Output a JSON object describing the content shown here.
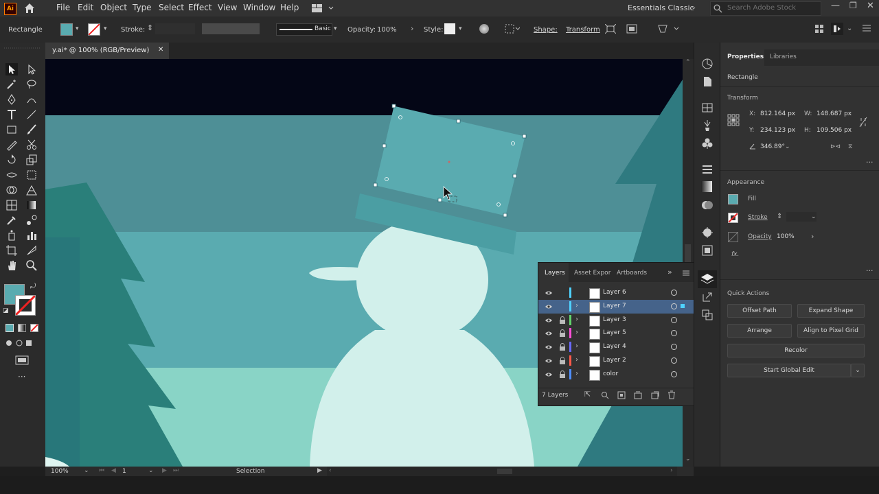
{
  "menubar": {
    "app_badge": "Ai",
    "items": [
      "File",
      "Edit",
      "Object",
      "Type",
      "Select",
      "Effect",
      "View",
      "Window",
      "Help"
    ],
    "workspace": "Essentials Classic",
    "search_placeholder": "Search Adobe Stock"
  },
  "controlbar": {
    "object_type": "Rectangle",
    "stroke_label": "Stroke:",
    "brush_label": "Basic",
    "opacity_label": "Opacity:",
    "opacity_value": "100%",
    "style_label": "Style:",
    "shape_label": "Shape:",
    "transform_label": "Transform",
    "fill_color": "#5aabb0"
  },
  "document": {
    "tab_title": "y.ai* @ 100% (RGB/Preview)",
    "close_glyph": "✕"
  },
  "status": {
    "zoom": "100%",
    "artboard": "1",
    "tool": "Selection"
  },
  "layers_panel": {
    "tabs": [
      "Layers",
      "Asset Expor",
      "Artboards"
    ],
    "rows": [
      {
        "name": "Layer 6",
        "color": "#4fd1ff",
        "locked": false,
        "expandable": false,
        "selected": false
      },
      {
        "name": "Layer 7",
        "color": "#4fd1ff",
        "locked": false,
        "expandable": true,
        "selected": true
      },
      {
        "name": "Layer 3",
        "color": "#62d46c",
        "locked": true,
        "expandable": true,
        "selected": false
      },
      {
        "name": "Layer 5",
        "color": "#ff4fd8",
        "locked": true,
        "expandable": true,
        "selected": false
      },
      {
        "name": "Layer 4",
        "color": "#6a6aff",
        "locked": true,
        "expandable": true,
        "selected": false
      },
      {
        "name": "Layer 2",
        "color": "#ff5a4a",
        "locked": true,
        "expandable": true,
        "selected": false
      },
      {
        "name": "color",
        "color": "#4f8fff",
        "locked": true,
        "expandable": true,
        "selected": false
      }
    ],
    "footer_count": "7 Layers"
  },
  "properties": {
    "tabs": [
      "Properties",
      "Libraries"
    ],
    "selection_type": "Rectangle",
    "transform_title": "Transform",
    "x_label": "X:",
    "x_value": "812.164 px",
    "y_label": "Y:",
    "y_value": "234.123 px",
    "w_label": "W:",
    "w_value": "148.687 px",
    "h_label": "H:",
    "h_value": "109.506 px",
    "angle_value": "346.89°",
    "appearance_title": "Appearance",
    "fill_label": "Fill",
    "stroke_label": "Stroke",
    "opacity_label": "Opacity",
    "opacity_value": "100%",
    "fx_label": "fx.",
    "quick_actions_title": "Quick Actions",
    "btn_offset_path": "Offset Path",
    "btn_expand_shape": "Expand Shape",
    "btn_arrange": "Arrange",
    "btn_align_pixel": "Align to Pixel Grid",
    "btn_recolor": "Recolor",
    "btn_global_edit": "Start Global Edit"
  },
  "colors": {
    "accent": "#5aabb0",
    "sky": "#040616",
    "panel": "#323232"
  }
}
